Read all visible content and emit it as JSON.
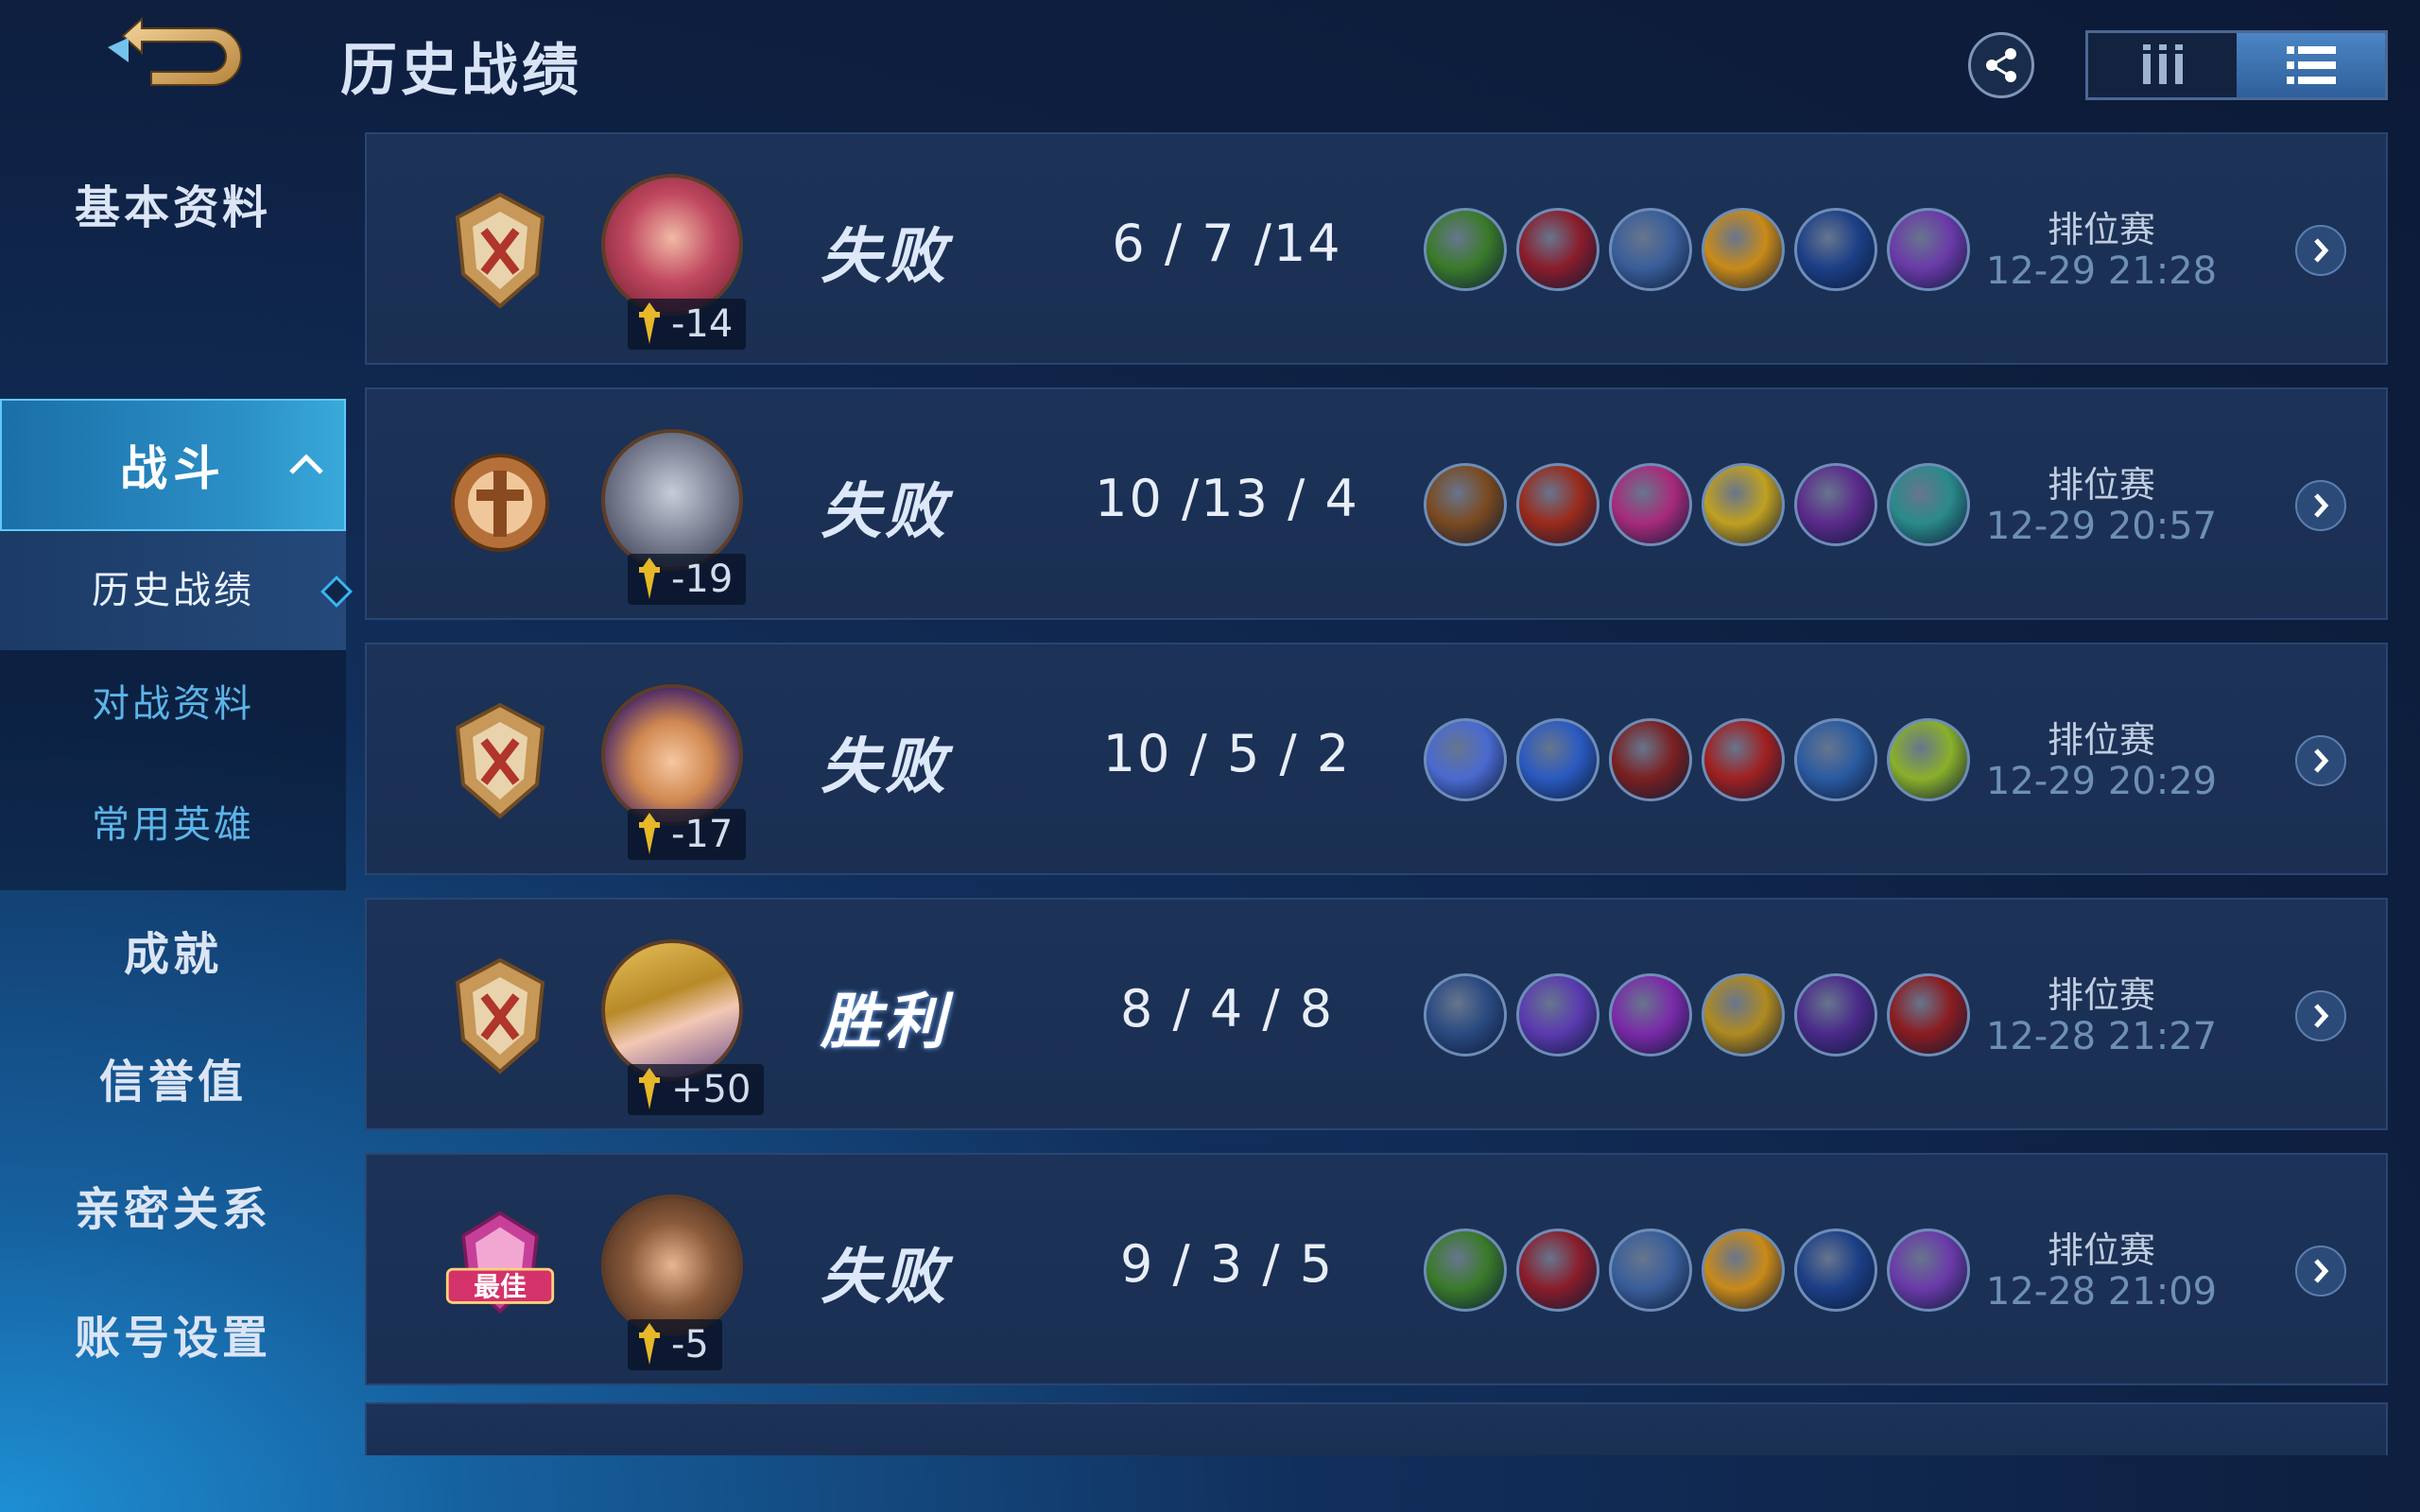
{
  "header": {
    "title": "历史战绩",
    "share_icon": "share-icon",
    "view_grid_icon": "grid-view-icon",
    "view_list_icon": "list-view-icon"
  },
  "sidebar": {
    "items": [
      {
        "label": "基本资料"
      },
      {
        "label": "战斗",
        "expanded": true
      },
      {
        "label": "成就"
      },
      {
        "label": "信誉值"
      },
      {
        "label": "亲密关系"
      },
      {
        "label": "账号设置"
      }
    ],
    "sub_items": [
      {
        "label": "历史战绩",
        "current": true
      },
      {
        "label": "对战资料"
      },
      {
        "label": "常用英雄"
      }
    ]
  },
  "matches": [
    {
      "rank_badge": "rank-badge-x-icon",
      "hero": "hero-avatar",
      "score": "-14",
      "result": "失败",
      "kda": "6 / 7 /14",
      "items": [
        "boots-item-icon",
        "claw-item-icon",
        "axe-item-icon",
        "gold-blade-item-icon",
        "moon-blade-item-icon",
        "purple-spear-item-icon"
      ],
      "mode": "排位赛",
      "time": "12-29 21:28"
    },
    {
      "rank_badge": "rank-badge-shield-icon",
      "hero": "hero-avatar",
      "score": "-19",
      "result": "失败",
      "kda": "10 /13 / 4",
      "items": [
        "boots-item-icon",
        "gun-item-icon",
        "armor-item-icon",
        "wing-item-icon",
        "golden-staff-item-icon",
        "helmet-item-icon"
      ],
      "mode": "排位赛",
      "time": "12-29 20:57"
    },
    {
      "rank_badge": "rank-badge-x-icon",
      "hero": "hero-avatar",
      "score": "-17",
      "result": "失败",
      "kda": "10 / 5 / 2",
      "items": [
        "magic-boots-item-icon",
        "orb-item-icon",
        "trident-item-icon",
        "lightning-orb-item-icon",
        "blue-staff-item-icon",
        "red-hood-item-icon"
      ],
      "mode": "排位赛",
      "time": "12-29 20:29"
    },
    {
      "rank_badge": "rank-badge-x-icon",
      "hero": "hero-avatar",
      "score": "+50",
      "result": "胜利",
      "kda": "8 / 4 / 8",
      "items": [
        "magic-boots-item-icon",
        "mask-item-icon",
        "trident-gold-item-icon",
        "wand-item-icon",
        "blue-staff-item-icon",
        "red-book-item-icon"
      ],
      "mode": "排位赛",
      "time": "12-28 21:27"
    },
    {
      "rank_badge": "mvp-badge-icon",
      "mvp_label": "最佳",
      "hero": "hero-avatar",
      "score": "-5",
      "result": "失败",
      "kda": "9 / 3 / 5",
      "items": [
        "gauntlet-item-icon",
        "trident-item-icon",
        "red-spear-item-icon",
        "moon-blade-item-icon",
        "green-bow-item-icon",
        "blue-sword-item-icon"
      ],
      "mode": "排位赛",
      "time": "12-28 21:09"
    }
  ],
  "colors": {
    "accent": "#39a9da",
    "item_palette": [
      "#3a7a2a",
      "#8a1c2a",
      "#3a5e9a",
      "#c98a18",
      "#1c3f86",
      "#6a3aa8",
      "#7a4a20",
      "#9a2a1a",
      "#a82a7a",
      "#c0a020",
      "#5a2a8a",
      "#2a8a8a",
      "#4a6ad0",
      "#2a5ac0",
      "#7a2020",
      "#a02020",
      "#2a5aa0",
      "#8ab02a",
      "#2a4a80",
      "#5a3ab0",
      "#7a2aa8",
      "#b08a20",
      "#4a2a8a",
      "#8a1c20"
    ]
  }
}
